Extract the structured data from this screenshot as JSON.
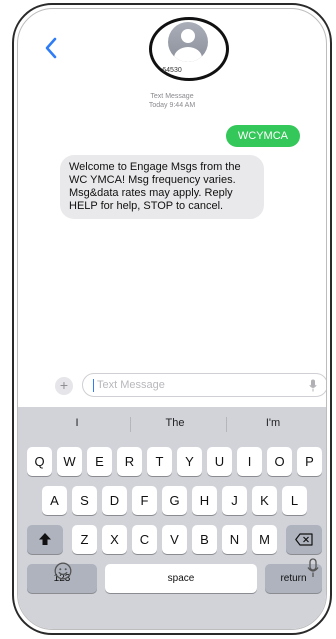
{
  "header": {
    "contact_name": "64530",
    "timestamp_type": "Text Message",
    "timestamp_time": "Today 9:44 AM"
  },
  "messages": [
    {
      "direction": "outgoing",
      "text": "WCYMCA"
    },
    {
      "direction": "incoming",
      "text": "Welcome to Engage Msgs from the WC YMCA! Msg frequency varies. Msg&data rates may apply. Reply HELP for help, STOP to cancel."
    }
  ],
  "composer": {
    "placeholder": "Text Message",
    "plus_label": "+"
  },
  "keyboard": {
    "suggestions": [
      "I",
      "The",
      "I'm"
    ],
    "row1": [
      "Q",
      "W",
      "E",
      "R",
      "T",
      "Y",
      "U",
      "I",
      "O",
      "P"
    ],
    "row2": [
      "A",
      "S",
      "D",
      "F",
      "G",
      "H",
      "J",
      "K",
      "L"
    ],
    "row3": [
      "Z",
      "X",
      "C",
      "V",
      "B",
      "N",
      "M"
    ],
    "numbers_label": "123",
    "space_label": "space",
    "return_label": "return"
  },
  "colors": {
    "outgoing_bubble": "#34c759",
    "incoming_bubble": "#e9e9eb",
    "accent": "#2f7cf6",
    "keyboard_bg": "#d1d3d9"
  },
  "icons": [
    "back-chevron-icon",
    "avatar-icon",
    "mic-icon",
    "emoji-icon",
    "shift-icon",
    "delete-icon"
  ]
}
